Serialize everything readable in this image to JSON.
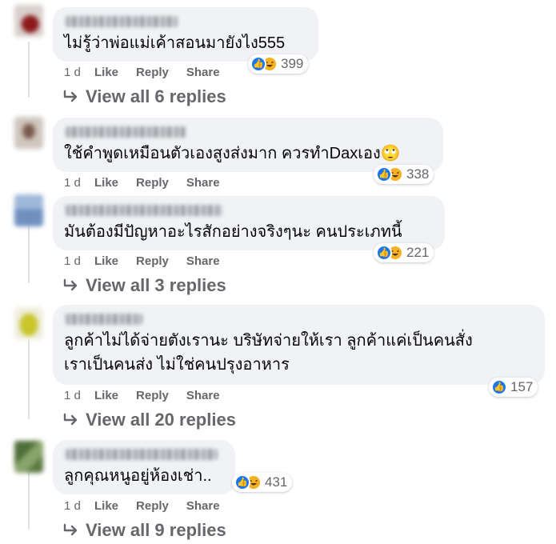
{
  "actions": {
    "like": "Like",
    "reply": "Reply",
    "share": "Share"
  },
  "colors": {
    "bubble": "#f0f2f5",
    "secondary_text": "#65676b",
    "like_blue": "#1877f2",
    "haha_yellow": "#f7b125",
    "thread_line": "#dfe1e5"
  },
  "comments": [
    {
      "text": "ไม่รู้ว่าพ่อแม่เค้าสอนมายังไง555",
      "time": "1 d",
      "reactions": {
        "icons": [
          "like-icon",
          "haha-icon"
        ],
        "count": "399"
      },
      "view_replies": "View all 6 replies"
    },
    {
      "text": "ใช้คำพูดเหมือนตัวเองสูงส่งมาก ควรทำDaxเอง🙄",
      "time": "1 d",
      "reactions": {
        "icons": [
          "like-icon",
          "haha-icon"
        ],
        "count": "338"
      },
      "view_replies": ""
    },
    {
      "text": "มันต้องมีปัญหาอะไรสักอย่างจริงๆนะ คนประเภทนี้",
      "time": "1 d",
      "reactions": {
        "icons": [
          "like-icon",
          "haha-icon"
        ],
        "count": "221"
      },
      "view_replies": "View all 3 replies"
    },
    {
      "text_lines": [
        "ลูกค้าไม่ได้จ่ายตังเรานะ บริษัทจ่ายให้เรา ลูกค้าแค่เป็นคนสั่ง",
        "เราเป็นคนส่ง ไม่ใช่คนปรุงอาหาร"
      ],
      "time": "1 d",
      "reactions": {
        "icons": [
          "like-icon"
        ],
        "count": "157"
      },
      "view_replies": "View all 20 replies"
    },
    {
      "text": "ลูกคุณหนูอยู่ห้องเช่า..",
      "time": "1 d",
      "reactions": {
        "icons": [
          "like-icon",
          "haha-icon"
        ],
        "count": "431"
      },
      "view_replies": "View all 9 replies"
    }
  ]
}
